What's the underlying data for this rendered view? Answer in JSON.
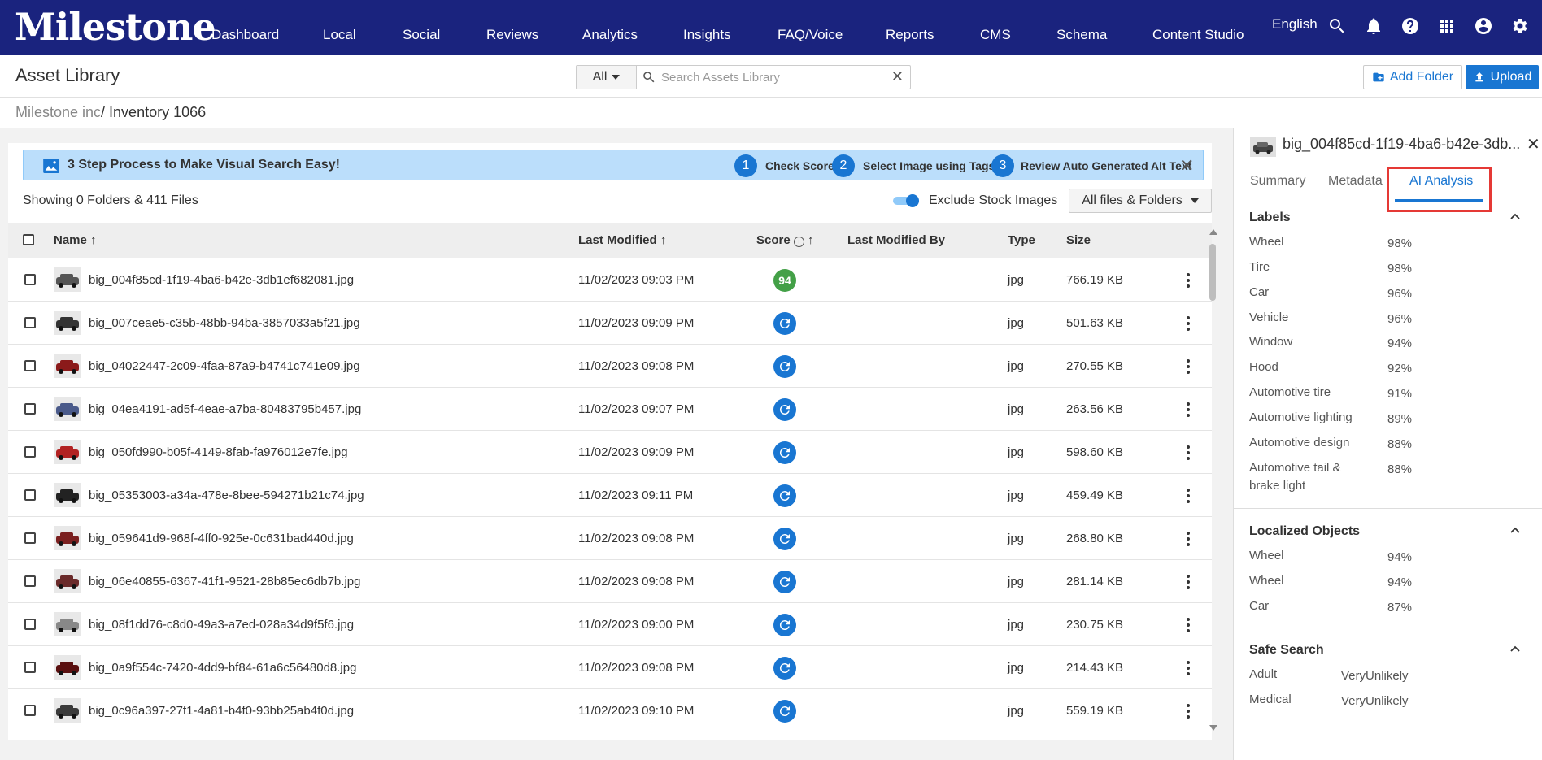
{
  "nav": {
    "logo": "Milestone",
    "items": [
      "Dashboard",
      "Local",
      "Social",
      "Reviews",
      "Analytics",
      "Insights",
      "FAQ/Voice",
      "Reports",
      "CMS",
      "Schema",
      "Content Studio"
    ],
    "language": "English"
  },
  "header": {
    "title": "Asset Library",
    "filter_value": "All",
    "search_placeholder": "Search Assets Library",
    "add_folder_label": "Add Folder",
    "upload_label": "Upload"
  },
  "breadcrumb": {
    "root": "Milestone inc",
    "current": "/ Inventory 1066"
  },
  "banner": {
    "title": "3 Step Process to Make Visual Search Easy!",
    "steps": [
      {
        "num": "1",
        "label": "Check Score"
      },
      {
        "num": "2",
        "label": "Select Image using Tags"
      },
      {
        "num": "3",
        "label": "Review Auto Generated Alt Text"
      }
    ]
  },
  "toolbar": {
    "showing": "Showing 0 Folders & 411 Files",
    "exclude_label": "Exclude Stock Images",
    "exclude_on": true,
    "files_filter": "All files & Folders"
  },
  "table": {
    "columns": [
      "Name",
      "Last Modified",
      "Score",
      "Last Modified By",
      "Type",
      "Size"
    ],
    "rows": [
      {
        "name": "big_004f85cd-1f19-4ba6-b42e-3db1ef682081.jpg",
        "modified": "11/02/2023 09:03 PM",
        "score": "94",
        "type": "jpg",
        "size": "766.19 KB"
      },
      {
        "name": "big_007ceae5-c35b-48bb-94ba-3857033a5f21.jpg",
        "modified": "11/02/2023 09:09 PM",
        "score": "",
        "type": "jpg",
        "size": "501.63 KB"
      },
      {
        "name": "big_04022447-2c09-4faa-87a9-b4741c741e09.jpg",
        "modified": "11/02/2023 09:08 PM",
        "score": "",
        "type": "jpg",
        "size": "270.55 KB"
      },
      {
        "name": "big_04ea4191-ad5f-4eae-a7ba-80483795b457.jpg",
        "modified": "11/02/2023 09:07 PM",
        "score": "",
        "type": "jpg",
        "size": "263.56 KB"
      },
      {
        "name": "big_050fd990-b05f-4149-8fab-fa976012e7fe.jpg",
        "modified": "11/02/2023 09:09 PM",
        "score": "",
        "type": "jpg",
        "size": "598.60 KB"
      },
      {
        "name": "big_05353003-a34a-478e-8bee-594271b21c74.jpg",
        "modified": "11/02/2023 09:11 PM",
        "score": "",
        "type": "jpg",
        "size": "459.49 KB"
      },
      {
        "name": "big_059641d9-968f-4ff0-925e-0c631bad440d.jpg",
        "modified": "11/02/2023 09:08 PM",
        "score": "",
        "type": "jpg",
        "size": "268.80 KB"
      },
      {
        "name": "big_06e40855-6367-41f1-9521-28b85ec6db7b.jpg",
        "modified": "11/02/2023 09:08 PM",
        "score": "",
        "type": "jpg",
        "size": "281.14 KB"
      },
      {
        "name": "big_08f1dd76-c8d0-49a3-a7ed-028a34d9f5f6.jpg",
        "modified": "11/02/2023 09:00 PM",
        "score": "",
        "type": "jpg",
        "size": "230.75 KB"
      },
      {
        "name": "big_0a9f554c-7420-4dd9-bf84-61a6c56480d8.jpg",
        "modified": "11/02/2023 09:08 PM",
        "score": "",
        "type": "jpg",
        "size": "214.43 KB"
      },
      {
        "name": "big_0c96a397-27f1-4a81-b4f0-93bb25ab4f0d.jpg",
        "modified": "11/02/2023 09:10 PM",
        "score": "",
        "type": "jpg",
        "size": "559.19 KB"
      }
    ]
  },
  "detail": {
    "title": "big_004f85cd-1f19-4ba6-b42e-3db...",
    "tabs": [
      "Summary",
      "Metadata",
      "AI Analysis"
    ],
    "active_tab": "AI Analysis",
    "labels_title": "Labels",
    "labels": [
      {
        "name": "Wheel",
        "pct": "98%"
      },
      {
        "name": "Tire",
        "pct": "98%"
      },
      {
        "name": "Car",
        "pct": "96%"
      },
      {
        "name": "Vehicle",
        "pct": "96%"
      },
      {
        "name": "Window",
        "pct": "94%"
      },
      {
        "name": "Hood",
        "pct": "92%"
      },
      {
        "name": "Automotive tire",
        "pct": "91%"
      },
      {
        "name": "Automotive lighting",
        "pct": "89%"
      },
      {
        "name": "Automotive design",
        "pct": "88%"
      },
      {
        "name": "Automotive tail & brake light",
        "pct": "88%"
      }
    ],
    "objects_title": "Localized Objects",
    "objects": [
      {
        "name": "Wheel",
        "pct": "94%"
      },
      {
        "name": "Wheel",
        "pct": "94%"
      },
      {
        "name": "Car",
        "pct": "87%"
      }
    ],
    "safe_title": "Safe Search",
    "safe": [
      {
        "name": "Adult",
        "value": "VeryUnlikely"
      },
      {
        "name": "Medical",
        "value": "VeryUnlikely"
      }
    ]
  },
  "colors": {
    "nav_bg": "#1a237e",
    "accent": "#1976d2",
    "score_good": "#43a047",
    "highlight": "#e53935"
  },
  "icons": [
    "search-icon",
    "bell-icon",
    "help-icon",
    "apps-grid-icon",
    "account-icon",
    "gear-icon",
    "refresh-icon",
    "kebab-menu-icon",
    "close-icon",
    "chevron-up-icon",
    "image-icon",
    "info-icon",
    "sort-arrow-icon"
  ]
}
